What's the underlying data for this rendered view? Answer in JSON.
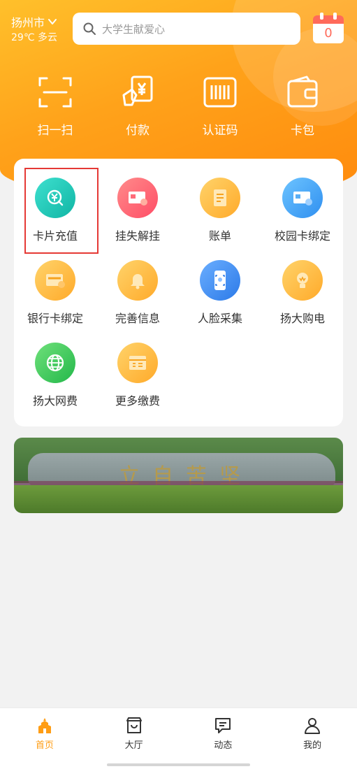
{
  "header": {
    "city": "扬州市",
    "weather": "29℃ 多云",
    "search_placeholder": "大学生献爱心",
    "calendar_day": "0"
  },
  "quick_actions": [
    {
      "label": "扫一扫",
      "icon": "scan-icon"
    },
    {
      "label": "付款",
      "icon": "payment-icon"
    },
    {
      "label": "认证码",
      "icon": "auth-code-icon"
    },
    {
      "label": "卡包",
      "icon": "wallet-icon"
    }
  ],
  "services": [
    {
      "label": "卡片充值",
      "icon": "card-recharge-icon",
      "color": "#19c9b8"
    },
    {
      "label": "挂失解挂",
      "icon": "report-loss-icon",
      "color": "#ff5f6f"
    },
    {
      "label": "账单",
      "icon": "bill-icon",
      "color": "#ffb636"
    },
    {
      "label": "校园卡绑定",
      "icon": "campus-card-bind-icon",
      "color": "#3fa7f5"
    },
    {
      "label": "银行卡绑定",
      "icon": "bank-card-bind-icon",
      "color": "#ffb636"
    },
    {
      "label": "完善信息",
      "icon": "bell-icon",
      "color": "#ffb636"
    },
    {
      "label": "人脸采集",
      "icon": "face-capture-icon",
      "color": "#3f8ef5"
    },
    {
      "label": "扬大购电",
      "icon": "lightbulb-icon",
      "color": "#ffb636"
    },
    {
      "label": "扬大网费",
      "icon": "globe-icon",
      "color": "#3fce5c"
    },
    {
      "label": "更多缴费",
      "icon": "more-payments-icon",
      "color": "#ffb636"
    }
  ],
  "banner": {
    "motto": "立自苦坚"
  },
  "tabbar": [
    {
      "label": "首页",
      "icon": "home-icon",
      "active": true
    },
    {
      "label": "大厅",
      "icon": "hall-icon",
      "active": false
    },
    {
      "label": "动态",
      "icon": "news-icon",
      "active": false
    },
    {
      "label": "我的",
      "icon": "profile-icon",
      "active": false
    }
  ],
  "colors": {
    "accent": "#ff9d14",
    "highlight_box": "#e53935"
  }
}
